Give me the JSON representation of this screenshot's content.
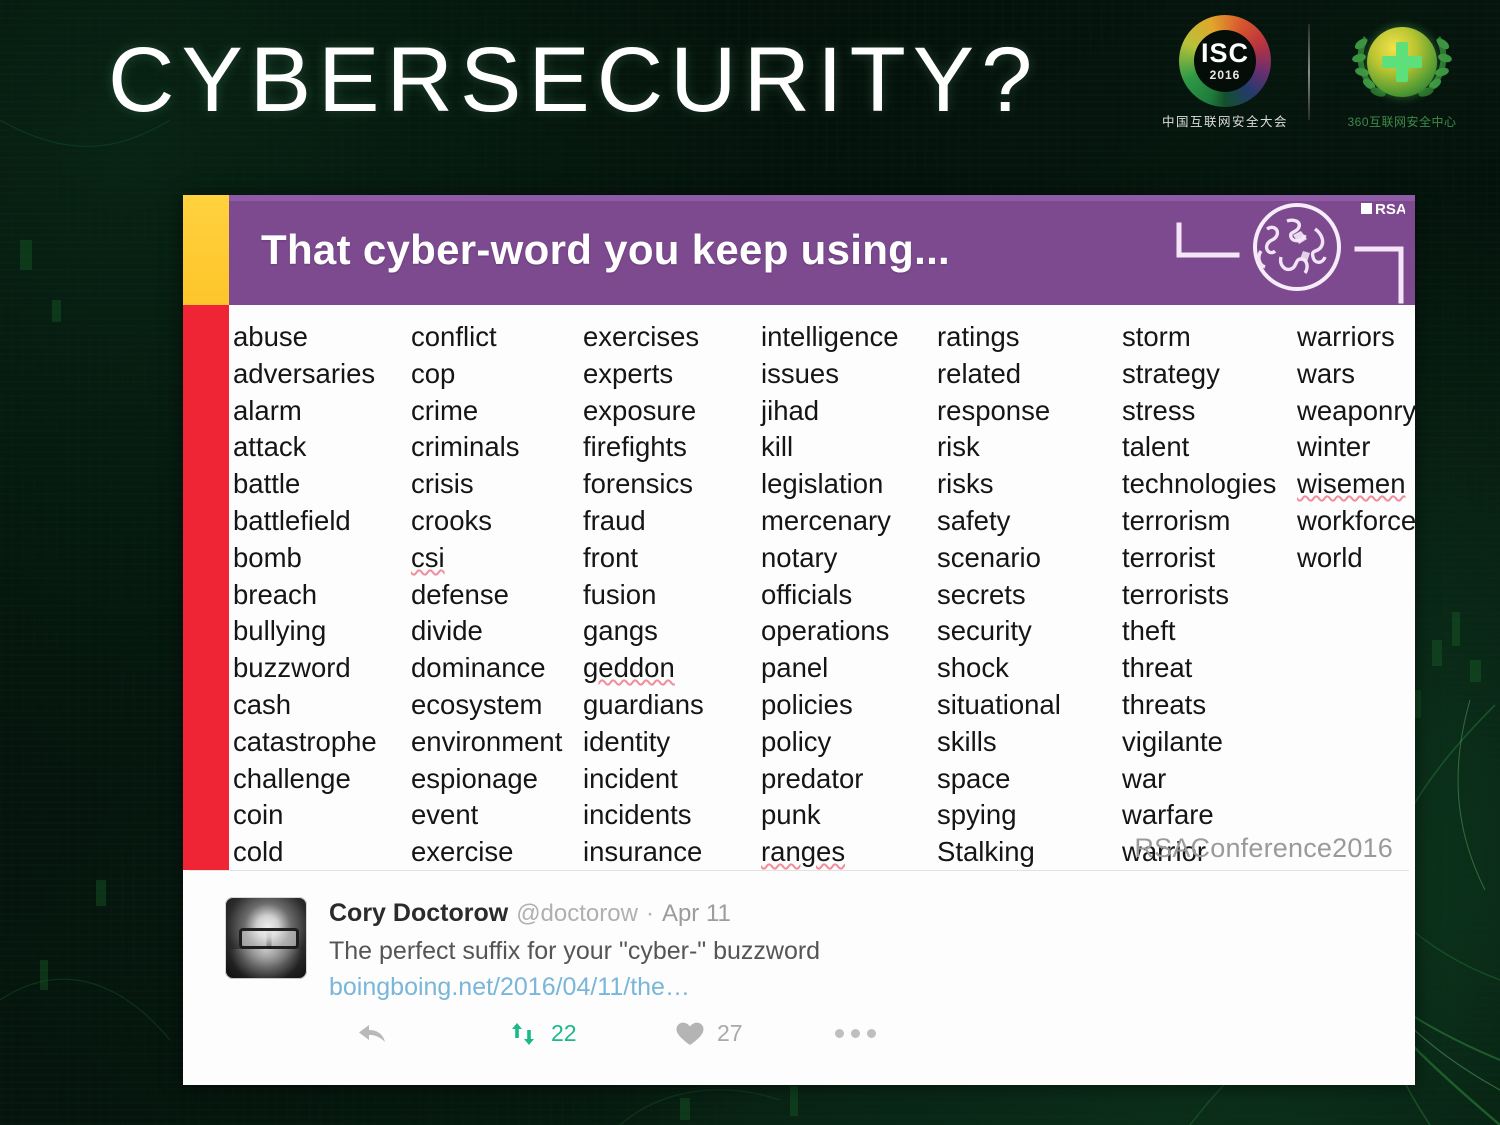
{
  "slide": {
    "title": "CYBERSECURITY?"
  },
  "logos": {
    "isc": {
      "acronym": "ISC",
      "year": "2016",
      "chinese": "中国互联网安全大会",
      "icon": "isc-ring-logo"
    },
    "cert360": {
      "chinese": "360互联网安全中心",
      "icon": "shield-cross-laurel-logo"
    }
  },
  "card": {
    "banner": {
      "title": "That cyber-word you keep using...",
      "rsac_tag": "RSAC",
      "globe_icon": "globe-network-icon",
      "accent_color": "#ffd23e",
      "background_color": "#7d4a90"
    },
    "rail_color": "#ef2434",
    "watermark": "RSAConference2016",
    "columns": [
      {
        "words": [
          "abuse",
          "adversaries",
          "alarm",
          "attack",
          "battle",
          "battlefield",
          "bomb",
          "breach",
          "bullying",
          "buzzword",
          "cash",
          "catastrophe",
          "challenge",
          "coin",
          "cold"
        ],
        "misspelled": []
      },
      {
        "words": [
          "conflict",
          "cop",
          "crime",
          "criminals",
          "crisis",
          "crooks",
          "csi",
          "defense",
          "divide",
          "dominance",
          "ecosystem",
          "environment",
          "espionage",
          "event",
          "exercise"
        ],
        "misspelled": [
          "csi"
        ]
      },
      {
        "words": [
          "exercises",
          "experts",
          "exposure",
          "firefights",
          "forensics",
          "fraud",
          "front",
          "fusion",
          "gangs",
          "geddon",
          "guardians",
          "identity",
          "incident",
          "incidents",
          "insurance"
        ],
        "misspelled": [
          "geddon"
        ]
      },
      {
        "words": [
          "intelligence",
          "issues",
          "jihad",
          "kill",
          "legislation",
          "mercenary",
          "notary",
          "officials",
          "operations",
          "panel",
          "policies",
          "policy",
          "predator",
          "punk",
          "ranges"
        ],
        "misspelled": [
          "ranges"
        ]
      },
      {
        "words": [
          "ratings",
          "related",
          "response",
          "risk",
          "risks",
          "safety",
          "scenario",
          "secrets",
          "security",
          "shock",
          "situational",
          "skills",
          "space",
          "spying",
          "Stalking"
        ],
        "misspelled": []
      },
      {
        "words": [
          "storm",
          "strategy",
          "stress",
          "talent",
          "technologies",
          "terrorism",
          "terrorist",
          "terrorists",
          "theft",
          "threat",
          "threats",
          "vigilante",
          "war",
          "warfare",
          "warrior"
        ],
        "misspelled": []
      },
      {
        "words": [
          "warriors",
          "wars",
          "weaponry",
          "winter",
          "wisemen",
          "workforce",
          "world"
        ],
        "misspelled": [
          "wisemen"
        ]
      }
    ]
  },
  "tweet": {
    "author_name": "Cory Doctorow",
    "handle": "@doctorow",
    "separator": "·",
    "date": "Apr 11",
    "text": "The perfect suffix for your \"cyber-\" buzzword",
    "link": "boingboing.net/2016/04/11/the…",
    "actions": {
      "reply_icon": "reply-arrow-icon",
      "retweet_icon": "retweet-icon",
      "retweet_count": "22",
      "like_icon": "heart-icon",
      "like_count": "27",
      "more_icon": "more-dots-icon"
    },
    "accent_green": "#1bb98a",
    "link_color": "#7ab6d9"
  }
}
